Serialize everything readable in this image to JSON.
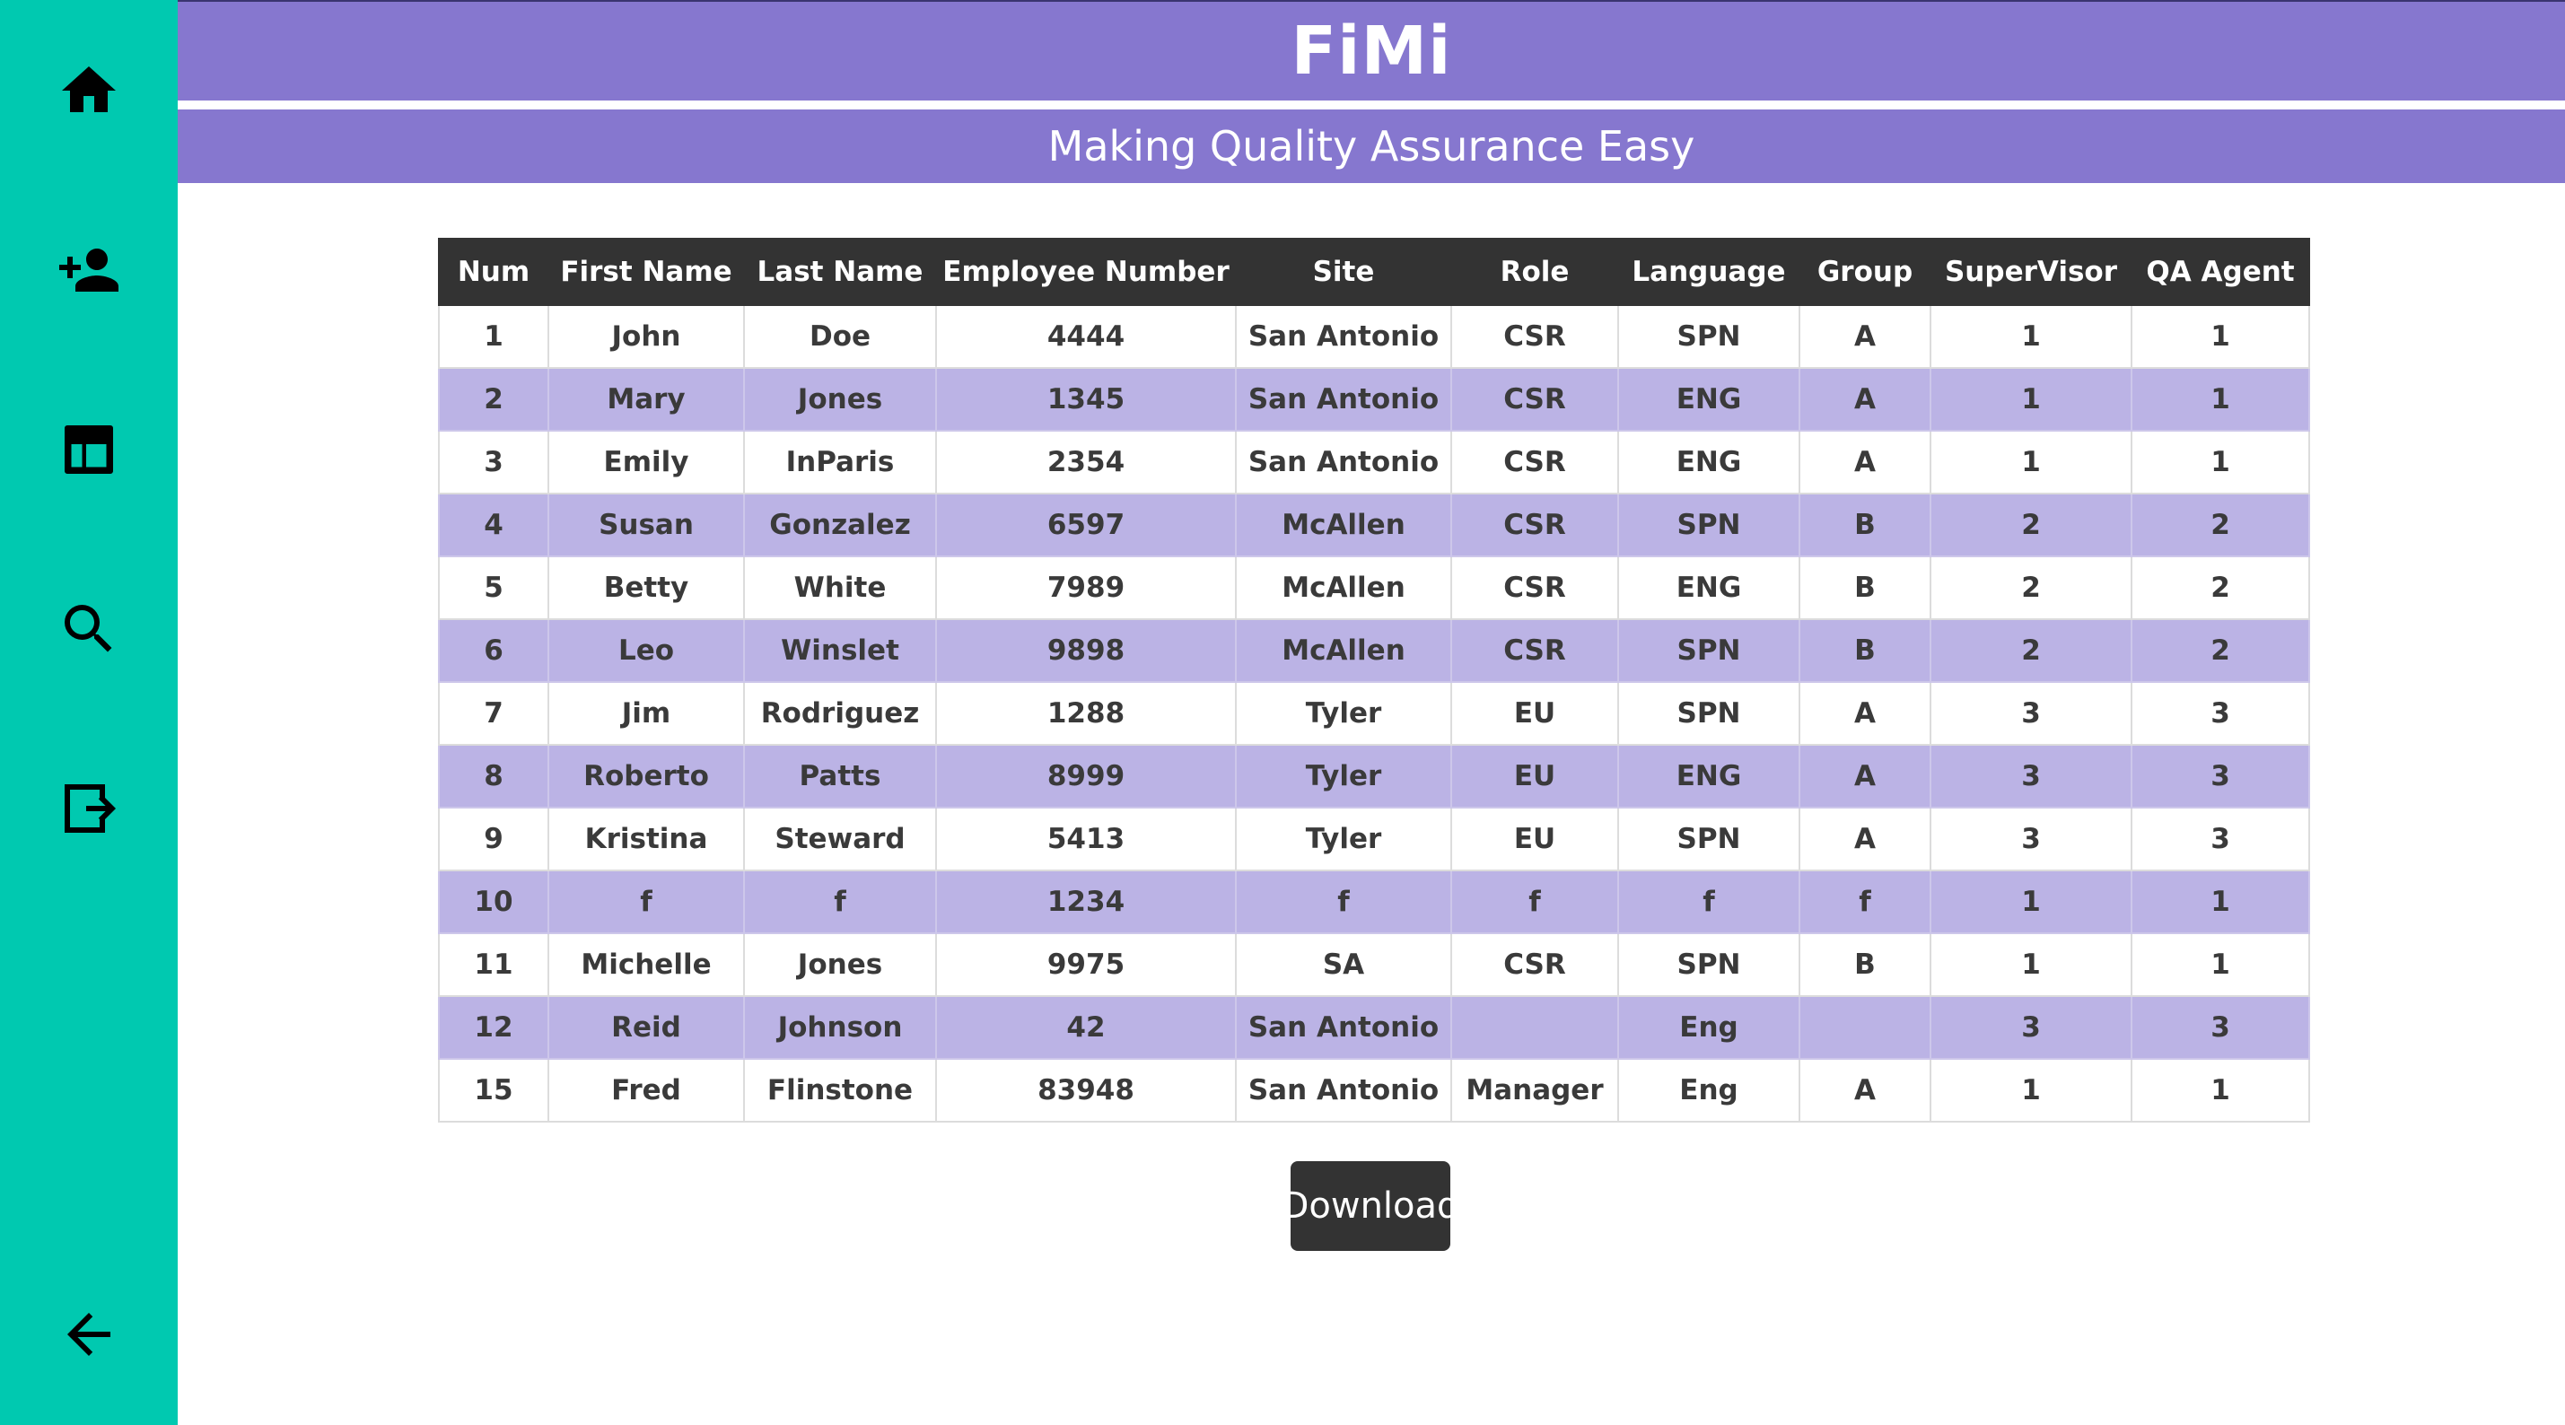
{
  "header": {
    "title": "FiMi",
    "subtitle": "Making Quality Assurance Easy"
  },
  "sidebar": {
    "items": [
      {
        "icon": "home-icon"
      },
      {
        "icon": "add-user-icon"
      },
      {
        "icon": "table-icon"
      },
      {
        "icon": "search-icon"
      },
      {
        "icon": "logout-icon"
      },
      {
        "icon": "back-arrow-icon"
      }
    ]
  },
  "table": {
    "headers": [
      "Num",
      "First Name",
      "Last Name",
      "Employee Number",
      "Site",
      "Role",
      "Language",
      "Group",
      "SuperVisor",
      "QA Agent"
    ],
    "rows": [
      [
        "1",
        "John",
        "Doe",
        "4444",
        "San Antonio",
        "CSR",
        "SPN",
        "A",
        "1",
        "1"
      ],
      [
        "2",
        "Mary",
        "Jones",
        "1345",
        "San Antonio",
        "CSR",
        "ENG",
        "A",
        "1",
        "1"
      ],
      [
        "3",
        "Emily",
        "InParis",
        "2354",
        "San Antonio",
        "CSR",
        "ENG",
        "A",
        "1",
        "1"
      ],
      [
        "4",
        "Susan",
        "Gonzalez",
        "6597",
        "McAllen",
        "CSR",
        "SPN",
        "B",
        "2",
        "2"
      ],
      [
        "5",
        "Betty",
        "White",
        "7989",
        "McAllen",
        "CSR",
        "ENG",
        "B",
        "2",
        "2"
      ],
      [
        "6",
        "Leo",
        "Winslet",
        "9898",
        "McAllen",
        "CSR",
        "SPN",
        "B",
        "2",
        "2"
      ],
      [
        "7",
        "Jim",
        "Rodriguez",
        "1288",
        "Tyler",
        "EU",
        "SPN",
        "A",
        "3",
        "3"
      ],
      [
        "8",
        "Roberto",
        "Patts",
        "8999",
        "Tyler",
        "EU",
        "ENG",
        "A",
        "3",
        "3"
      ],
      [
        "9",
        "Kristina",
        "Steward",
        "5413",
        "Tyler",
        "EU",
        "SPN",
        "A",
        "3",
        "3"
      ],
      [
        "10",
        "f",
        "f",
        "1234",
        "f",
        "f",
        "f",
        "f",
        "1",
        "1"
      ],
      [
        "11",
        "Michelle",
        "Jones",
        "9975",
        "SA",
        "CSR",
        "SPN",
        "B",
        "1",
        "1"
      ],
      [
        "12",
        "Reid",
        "Johnson",
        "42",
        "San Antonio",
        "",
        "Eng",
        "",
        "3",
        "3"
      ],
      [
        "15",
        "Fred",
        "Flinstone",
        "83948",
        "San Antonio",
        "Manager",
        "Eng",
        "A",
        "1",
        "1"
      ]
    ]
  },
  "actions": {
    "download_label": "Download"
  },
  "colors": {
    "sidebar": "#00c9b0",
    "header": "#8677cf",
    "row_alt": "#bbb3e5",
    "table_header": "#333333"
  }
}
